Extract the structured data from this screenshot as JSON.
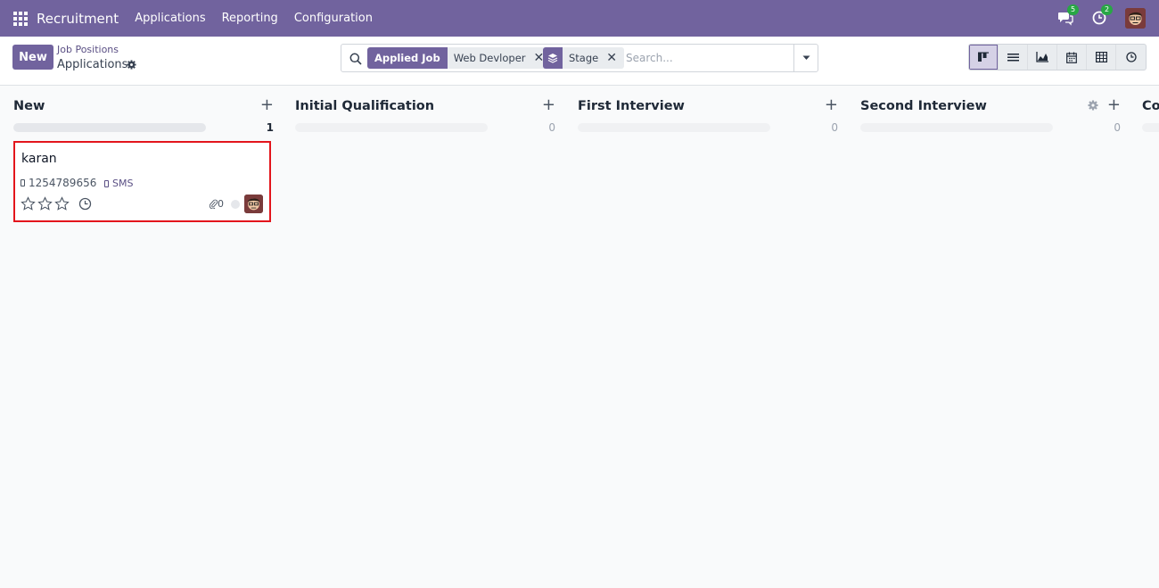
{
  "navbar": {
    "brand": "Recruitment",
    "menu": [
      "Applications",
      "Reporting",
      "Configuration"
    ],
    "messages_count": "5",
    "activities_count": "2"
  },
  "control": {
    "new_label": "New",
    "breadcrumb_parent": "Job Positions",
    "breadcrumb_current": "Applications"
  },
  "search": {
    "facets": [
      {
        "label": "Applied Job",
        "value": "Web Devloper"
      },
      {
        "label": "",
        "value": "Stage"
      }
    ],
    "placeholder": "Search...",
    "value": ""
  },
  "views": [
    "kanban-icon",
    "list-icon",
    "graph-icon",
    "calendar-icon",
    "pivot-icon",
    "activity-icon"
  ],
  "colors": {
    "primary": "#71639e",
    "highlight": "#e3151c",
    "badge": "#28a745"
  },
  "columns": [
    {
      "title": "New",
      "count": "1"
    },
    {
      "title": "Initial Qualification",
      "count": "0"
    },
    {
      "title": "First Interview",
      "count": "0"
    },
    {
      "title": "Second Interview",
      "count": "0"
    },
    {
      "title": "Co",
      "count": ""
    }
  ],
  "card": {
    "name": "karan",
    "phone": "1254789656",
    "sms": "SMS",
    "attachments": "0",
    "priority_stars": 0
  }
}
